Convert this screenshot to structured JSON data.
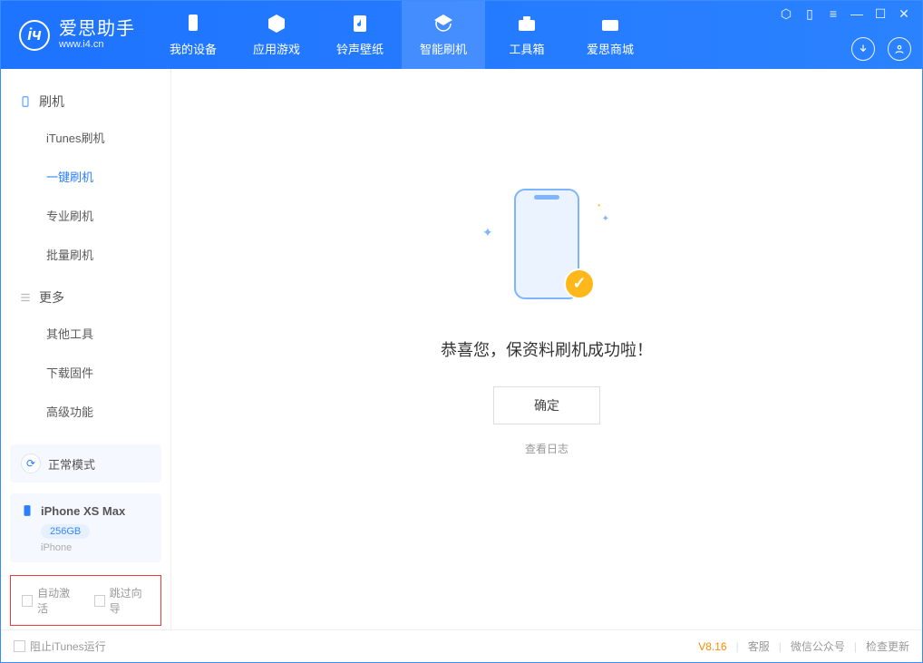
{
  "app": {
    "name": "爱思助手",
    "url": "www.i4.cn"
  },
  "nav": [
    {
      "label": "我的设备"
    },
    {
      "label": "应用游戏"
    },
    {
      "label": "铃声壁纸"
    },
    {
      "label": "智能刷机"
    },
    {
      "label": "工具箱"
    },
    {
      "label": "爱思商城"
    }
  ],
  "sidebar": {
    "section_flash": "刷机",
    "flash_items": [
      {
        "label": "iTunes刷机"
      },
      {
        "label": "一键刷机"
      },
      {
        "label": "专业刷机"
      },
      {
        "label": "批量刷机"
      }
    ],
    "section_more": "更多",
    "more_items": [
      {
        "label": "其他工具"
      },
      {
        "label": "下载固件"
      },
      {
        "label": "高级功能"
      }
    ],
    "status_mode": "正常模式",
    "device": {
      "name": "iPhone XS Max",
      "storage": "256GB",
      "type": "iPhone"
    },
    "auto_activate": "自动激活",
    "skip_guide": "跳过向导"
  },
  "main": {
    "success_msg": "恭喜您，保资料刷机成功啦！",
    "ok": "确定",
    "view_log": "查看日志"
  },
  "footer": {
    "block_itunes": "阻止iTunes运行",
    "version": "V8.16",
    "support": "客服",
    "wechat": "微信公众号",
    "check_update": "检查更新"
  }
}
